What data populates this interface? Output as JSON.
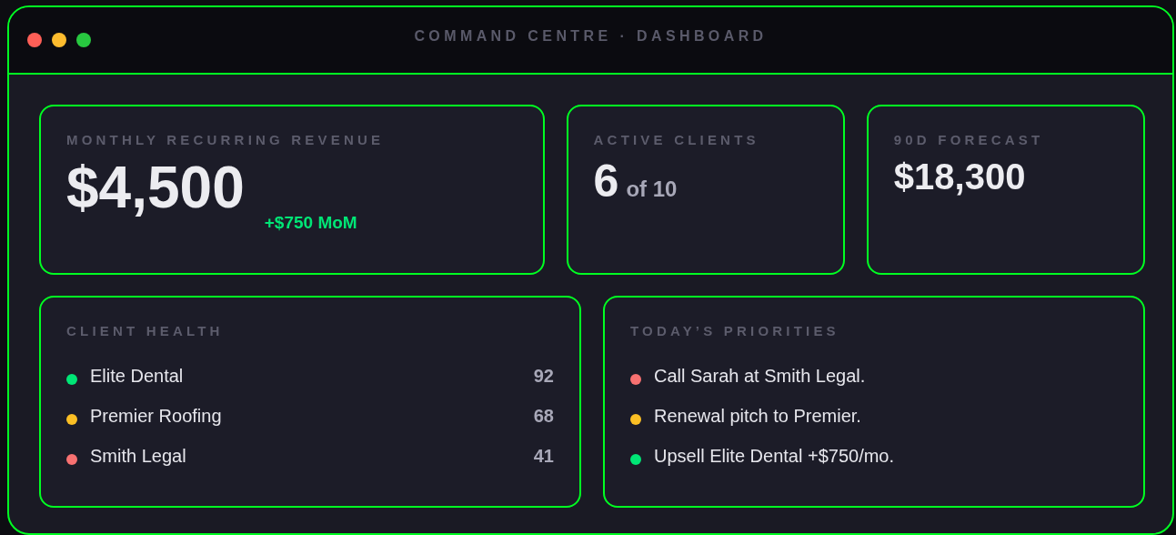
{
  "window": {
    "title": "COMMAND CENTRE · DASHBOARD",
    "controls": [
      {
        "color": "#ff5f57"
      },
      {
        "color": "#febc2e"
      },
      {
        "color": "#28c840"
      }
    ]
  },
  "metrics": [
    {
      "label": "MONTHLY RECURRING REVENUE",
      "value": "$4,500",
      "kind": "revenue",
      "delta": "+$750 MoM"
    },
    {
      "label": "ACTIVE CLIENTS",
      "value": "6",
      "kind": "clients",
      "suffix": "of 10"
    },
    {
      "label": "90D FORECAST",
      "value": "$18,300",
      "kind": "forecast"
    }
  ],
  "client_health": {
    "title": "CLIENT HEALTH",
    "items": [
      {
        "name": "Elite Dental",
        "score": "92",
        "color": "#00e676"
      },
      {
        "name": "Premier Roofing",
        "score": "68",
        "color": "#fbbf24"
      },
      {
        "name": "Smith Legal",
        "score": "41",
        "color": "#f87171"
      }
    ]
  },
  "priorities": {
    "title": "TODAY’S PRIORITIES",
    "items": [
      {
        "text": "Call Sarah at Smith Legal.",
        "color": "#f87171"
      },
      {
        "text": "Renewal pitch to Premier.",
        "color": "#fbbf24"
      },
      {
        "text": "Upsell Elite Dental +$750/mo.",
        "color": "#00e676"
      }
    ]
  }
}
